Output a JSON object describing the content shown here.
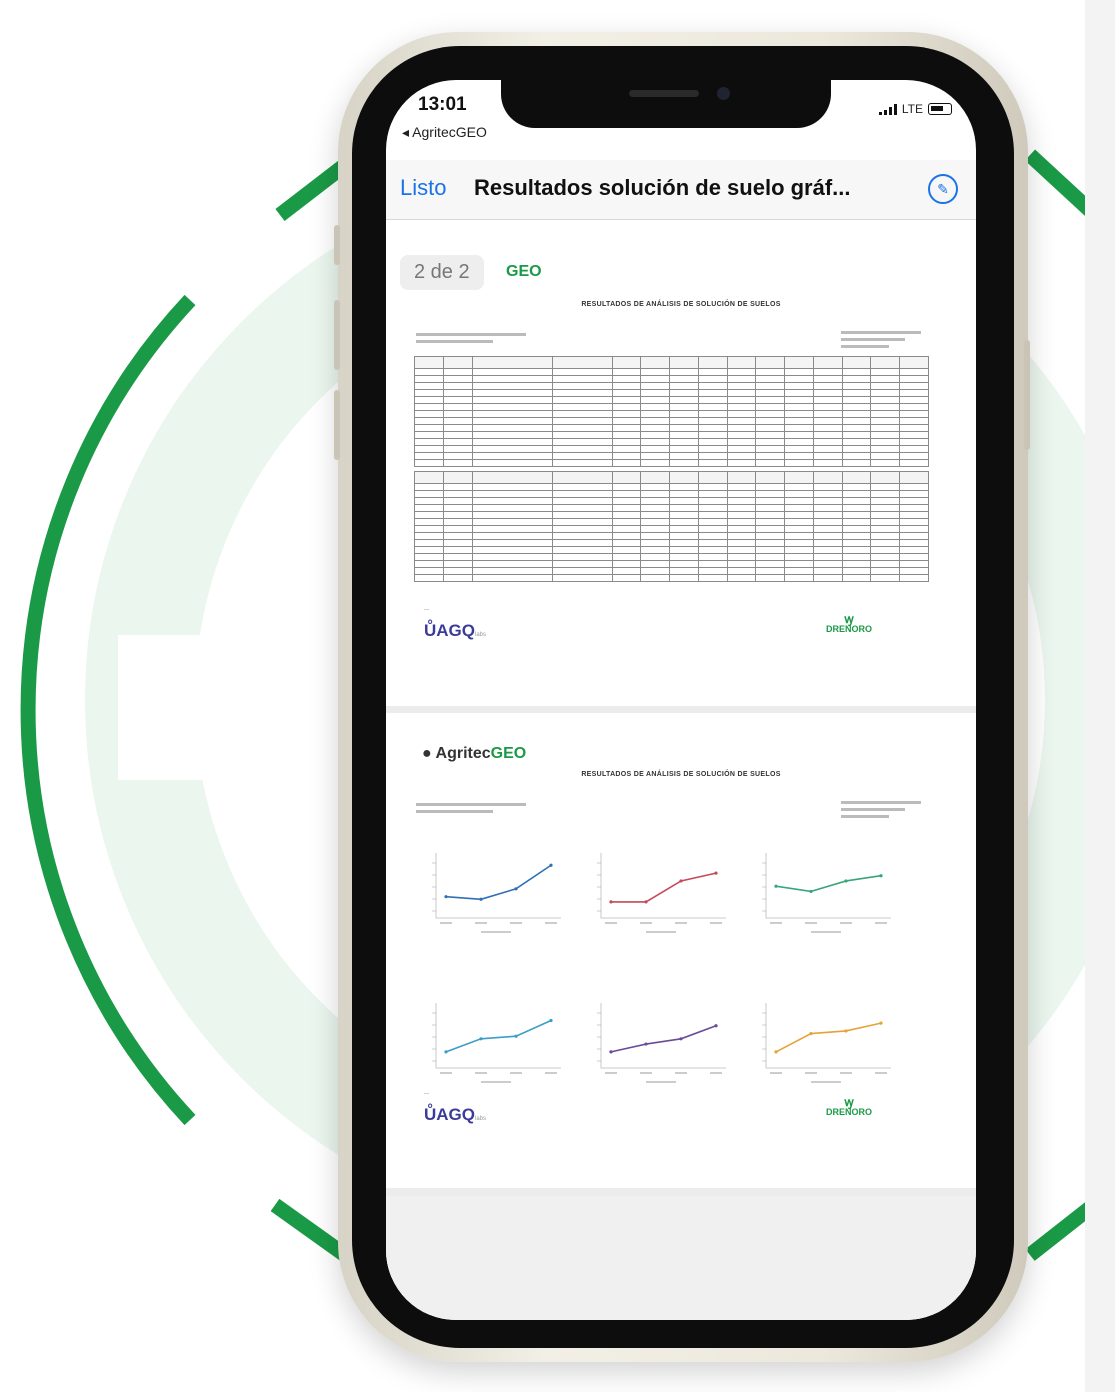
{
  "colors": {
    "brand_green": "#1a9a46",
    "link_blue": "#1a73e8"
  },
  "status_bar": {
    "time": "13:01",
    "back_app": "AgritecGEO",
    "network": "LTE"
  },
  "nav": {
    "done_label": "Listo",
    "title": "Resultados solución de suelo gráf...",
    "icon": "markup-pen-icon"
  },
  "page1": {
    "counter": "2 de 2",
    "brand_fragment": "GEO",
    "title": "RESULTADOS DE ANÁLISIS DE SOLUCIÓN DE SUELOS",
    "logo_left": "AGQ",
    "logo_right": "DRENORO"
  },
  "page2": {
    "brand_prefix": "Agritec",
    "brand_suffix": "GEO",
    "title": "RESULTADOS DE ANÁLISIS DE SOLUCIÓN DE SUELOS",
    "logo_left": "AGQ",
    "logo_right": "DRENORO"
  },
  "mini_charts": [
    {
      "color": "#2f6fb5",
      "values": [
        1.2,
        1.1,
        1.5,
        2.4
      ]
    },
    {
      "color": "#c24a5a",
      "values": [
        1.0,
        1.0,
        1.8,
        2.1
      ]
    },
    {
      "color": "#3aa57a",
      "values": [
        1.6,
        1.4,
        1.8,
        2.0
      ]
    },
    {
      "color": "#3a9ec6",
      "values": [
        1.0,
        1.5,
        1.6,
        2.2
      ]
    },
    {
      "color": "#6b4a9a",
      "values": [
        1.0,
        1.3,
        1.5,
        2.0
      ]
    },
    {
      "color": "#e6a23a",
      "values": [
        1.0,
        1.7,
        1.8,
        2.1
      ]
    }
  ]
}
